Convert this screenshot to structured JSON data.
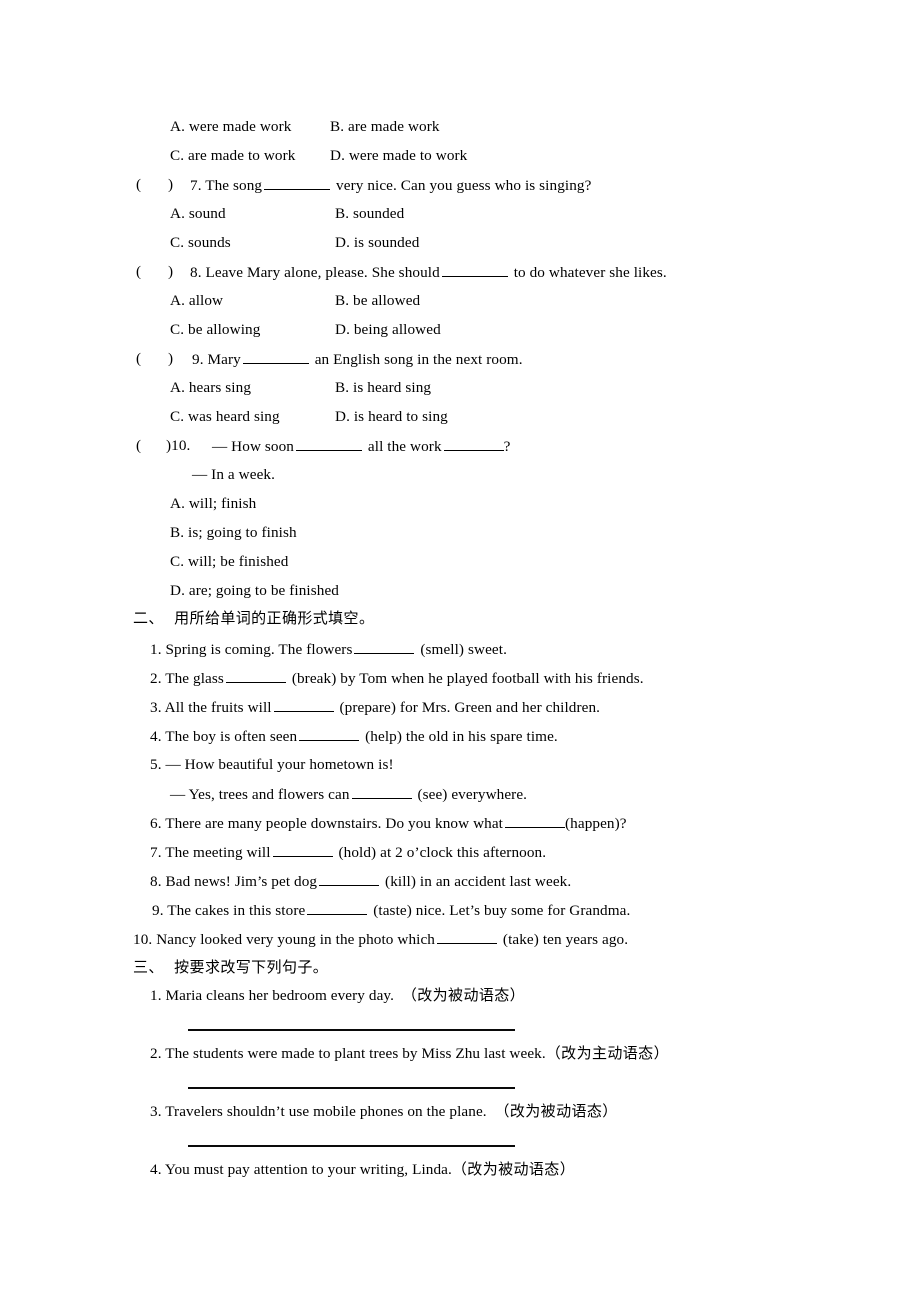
{
  "document": {
    "type": "worksheet",
    "language": "en-zh",
    "background_color": "#ffffff",
    "text_color": "#000000"
  },
  "section_one_tail": {
    "description": "Trailing options of multiple-choice question 6 and questions 7-10",
    "q6_options": [
      {
        "left": "A. were made work",
        "right": "B. are made work"
      },
      {
        "left": "C. are made to work",
        "right": "D. were made to work"
      }
    ],
    "questions": [
      {
        "marker_open": "(",
        "marker_close": ")",
        "number": "7.",
        "stem_before": "The song",
        "stem_after": "very nice. Can you guess who is singing?",
        "options": [
          {
            "left": "A. sound",
            "right": "B. sounded"
          },
          {
            "left": "C. sounds",
            "right": "D. is sounded"
          }
        ]
      },
      {
        "marker_open": "(",
        "marker_close": ")",
        "number": "8.",
        "stem_before": "Leave Mary alone, please. She should",
        "stem_after": "to do whatever she likes.",
        "options": [
          {
            "left": "A. allow",
            "right": "B. be allowed"
          },
          {
            "left": "C. be allowing",
            "right": "D. being allowed"
          }
        ]
      },
      {
        "marker_open": "(",
        "marker_close": ")",
        "number": "9.",
        "stem_before": "Mary",
        "stem_after": "an English song in the next room.",
        "options": [
          {
            "left": "A. hears sing",
            "right": "B. is heard sing"
          },
          {
            "left": "C. was heard sing",
            "right": "D. is heard to sing"
          }
        ]
      },
      {
        "marker_open": "(",
        "marker_close": ")10.",
        "number": "",
        "stem_before": "— How soon",
        "stem_mid": "all the work",
        "stem_after": "?",
        "answer_line": "— In a week.",
        "options_stacked": [
          "A. will; finish",
          "B. is; going to finish",
          "C. will; be finished",
          "D. are; going to be finished"
        ]
      }
    ]
  },
  "section_two": {
    "number": "二、",
    "title": "用所给单词的正确形式填空。",
    "items": [
      {
        "num": "1.",
        "before": "Spring is coming. The flowers",
        "after": "(smell) sweet."
      },
      {
        "num": "2.",
        "before": "The glass",
        "after": "(break) by Tom when he played football with his friends."
      },
      {
        "num": "3.",
        "before": "All the fruits will",
        "after": "(prepare) for Mrs. Green and her children."
      },
      {
        "num": "4.",
        "before": "The boy is often seen",
        "after": "(help) the old in his spare time."
      },
      {
        "num": "5.",
        "before": "— How beautiful your hometown is!",
        "after": "",
        "second_line_before": "— Yes, trees and flowers can",
        "second_line_after": "(see) everywhere."
      },
      {
        "num": "6.",
        "before": "There are many people downstairs. Do you know what",
        "after": "(happen)?"
      },
      {
        "num": "7.",
        "before": "The meeting will",
        "after": "(hold) at 2 o’clock this afternoon."
      },
      {
        "num": "8.",
        "before": "Bad news! Jim’s pet dog",
        "after": "(kill) in an accident last week."
      },
      {
        "num": "9.",
        "before": "The cakes in this store",
        "after": "(taste) nice. Let’s buy some for Grandma."
      },
      {
        "num": "10.",
        "before": "Nancy looked very young in the photo which",
        "after": "(take) ten years ago."
      }
    ]
  },
  "section_three": {
    "number": "三、",
    "title": "按要求改写下列句子。",
    "items": [
      {
        "num": "1.",
        "sentence": "Maria cleans her bedroom every day.",
        "instruction": "（改为被动语态）",
        "has_answer_rule": true
      },
      {
        "num": "2.",
        "sentence": "The students were made to plant trees by Miss Zhu last week.",
        "instruction": "（改为主动语态）",
        "has_answer_rule": true
      },
      {
        "num": "3.",
        "sentence": "Travelers shouldn’t use mobile phones on the plane.",
        "instruction": "（改为被动语态）",
        "has_answer_rule": true
      },
      {
        "num": "4.",
        "sentence": "You must pay attention to your writing, Linda.",
        "instruction": "（改为被动语态）",
        "has_answer_rule": false
      }
    ]
  }
}
